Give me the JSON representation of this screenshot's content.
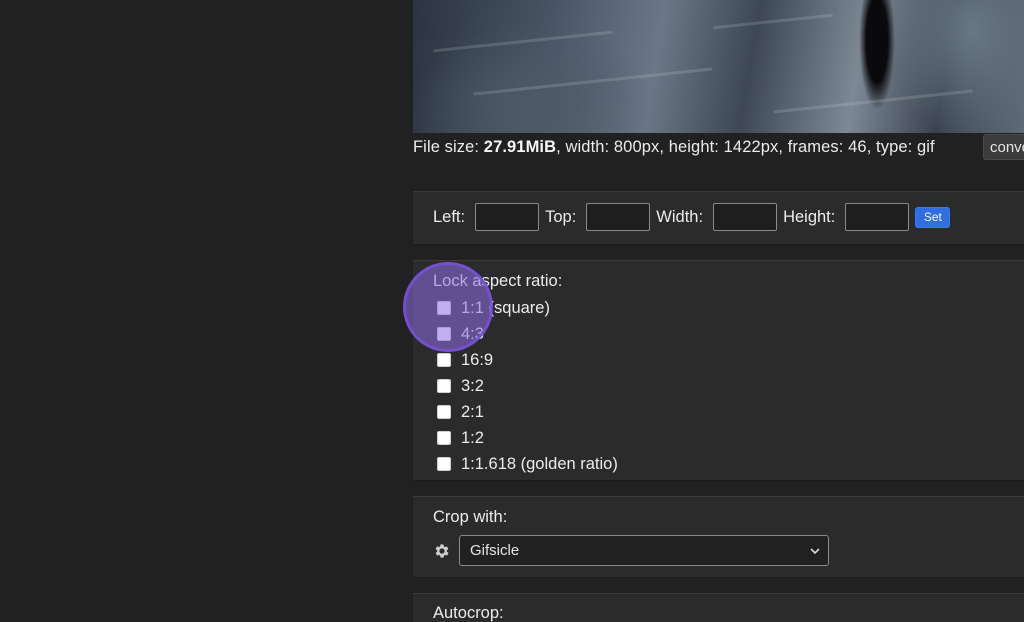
{
  "file_info": {
    "prefix": "File size: ",
    "size": "27.91MiB",
    "details": ", width: 800px, height: 1422px, frames: 46, type: gif"
  },
  "convert_button": {
    "label": "convert"
  },
  "dimensions": {
    "left_label": "Left:",
    "top_label": "Top:",
    "width_label": "Width:",
    "height_label": "Height:",
    "left_value": "",
    "top_value": "",
    "width_value": "",
    "height_value": "",
    "set_label": "Set"
  },
  "aspect": {
    "title": "Lock aspect ratio:",
    "options": [
      {
        "label": "1:1 (square)",
        "checked": false
      },
      {
        "label": "4:3",
        "checked": false
      },
      {
        "label": "16:9",
        "checked": false
      },
      {
        "label": "3:2",
        "checked": false
      },
      {
        "label": "2:1",
        "checked": false
      },
      {
        "label": "1:2",
        "checked": false
      },
      {
        "label": "1:1.618 (golden ratio)",
        "checked": false
      }
    ]
  },
  "crop": {
    "title": "Crop with:",
    "icon": "gear-icon",
    "selected": "Gifsicle"
  },
  "autocrop": {
    "title": "Autocrop:"
  },
  "colors": {
    "accent": "#2f6fe0",
    "cursor_highlight": "#8c6ee6"
  }
}
